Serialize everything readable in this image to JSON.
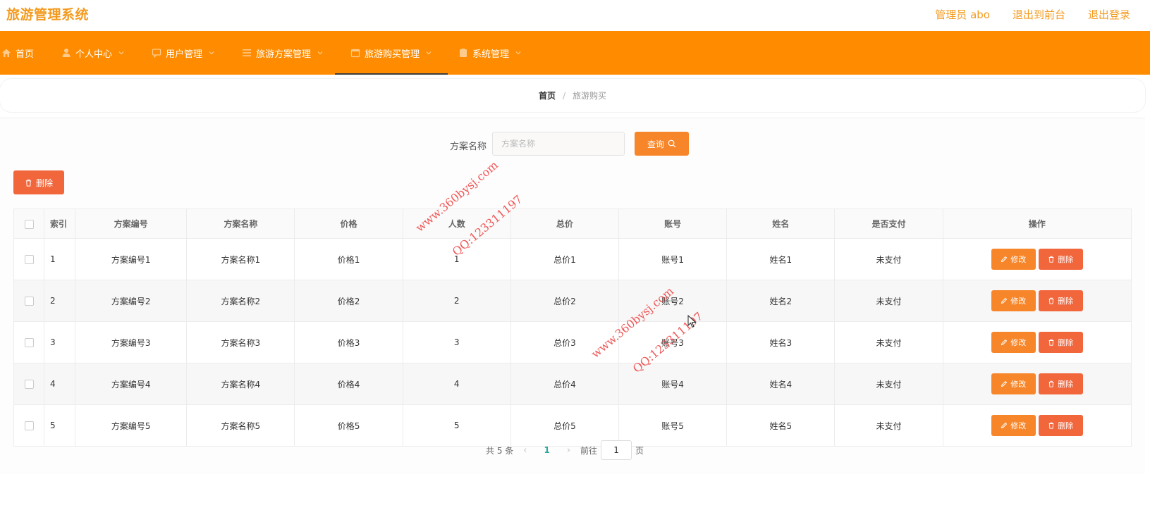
{
  "header": {
    "title": "旅游管理系统",
    "links": [
      "管理员 abo",
      "退出到前台",
      "退出登录"
    ]
  },
  "nav": {
    "items": [
      {
        "label": "首页",
        "icon": "home-icon"
      },
      {
        "label": "个人中心",
        "icon": "user-icon"
      },
      {
        "label": "用户管理",
        "icon": "chat-icon"
      },
      {
        "label": "旅游方案管理",
        "icon": "list-icon"
      },
      {
        "label": "旅游购买管理",
        "icon": "calendar-icon"
      },
      {
        "label": "系统管理",
        "icon": "clipboard-icon"
      }
    ],
    "active_index": 4
  },
  "breadcrumb": {
    "home": "首页",
    "separator": "/",
    "current": "旅游购买"
  },
  "search": {
    "label": "方案名称",
    "placeholder": "方案名称",
    "button": "查询"
  },
  "toolbar": {
    "delete_label": "删除"
  },
  "table": {
    "columns": [
      "索引",
      "方案编号",
      "方案名称",
      "价格",
      "人数",
      "总价",
      "账号",
      "姓名",
      "是否支付",
      "操作"
    ],
    "rows": [
      [
        "1",
        "方案编号1",
        "方案名称1",
        "价格1",
        "1",
        "总价1",
        "账号1",
        "姓名1",
        "未支付"
      ],
      [
        "2",
        "方案编号2",
        "方案名称2",
        "价格2",
        "2",
        "总价2",
        "账号2",
        "姓名2",
        "未支付"
      ],
      [
        "3",
        "方案编号3",
        "方案名称3",
        "价格3",
        "3",
        "总价3",
        "账号3",
        "姓名3",
        "未支付"
      ],
      [
        "4",
        "方案编号4",
        "方案名称4",
        "价格4",
        "4",
        "总价4",
        "账号4",
        "姓名4",
        "未支付"
      ],
      [
        "5",
        "方案编号5",
        "方案名称5",
        "价格5",
        "5",
        "总价5",
        "账号5",
        "姓名5",
        "未支付"
      ]
    ],
    "edit_label": "修改",
    "delete_label": "删除"
  },
  "pagination": {
    "total_text": "共 5 条",
    "current_page": "1",
    "goto_prefix": "前往",
    "goto_value": "1",
    "goto_suffix": "页"
  },
  "watermark": {
    "site": "www.360bysj.com",
    "qq": "QQ:123311197"
  },
  "colors": {
    "accent": "#f39a1e",
    "nav_bg": "#ff8c00",
    "primary_btn": "#f7862a",
    "danger_btn": "#f2663c",
    "page_active": "#2ca89e"
  }
}
